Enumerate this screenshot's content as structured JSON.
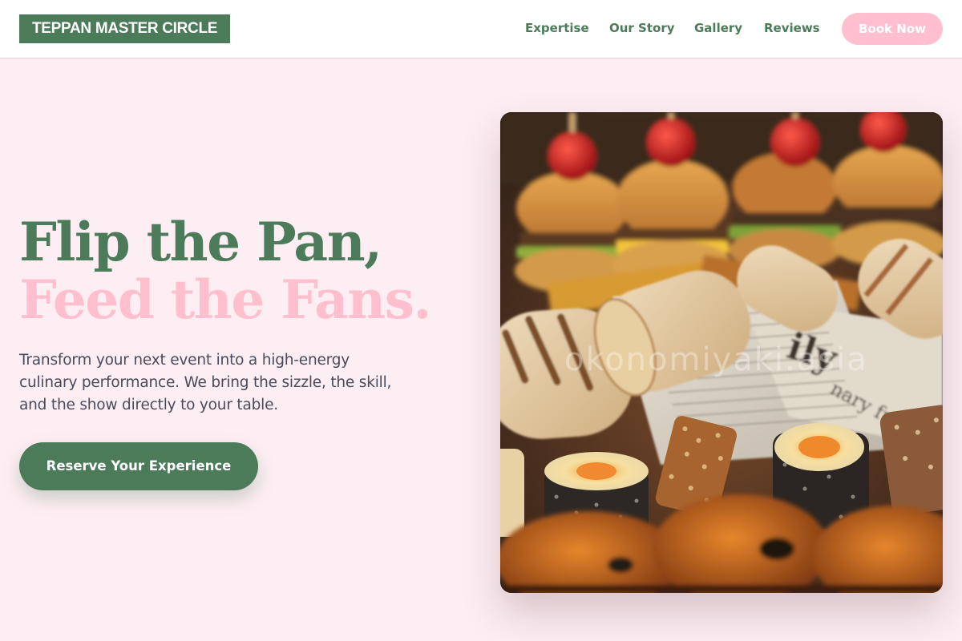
{
  "brand": {
    "name": "TEPPAN MASTER CIRCLE"
  },
  "nav": {
    "items": [
      "Expertise",
      "Our Story",
      "Gallery",
      "Reviews"
    ],
    "cta_label": "Book Now"
  },
  "hero": {
    "headline_line1": "Flip the Pan,",
    "headline_line2": "Feed the Fans.",
    "description": "Transform your next event into a high-energy culinary performance. We bring the sizzle, the skill, and the show directly to your table.",
    "cta_label": "Reserve Your Experience",
    "image_alt": "Platter of mini burgers, wraps in newspaper, sushi rolls and grilled bites",
    "image_watermark": "okonomiyaki.asia"
  },
  "colors": {
    "brand_green": "#4b7b59",
    "accent_pink": "#ffbfcf",
    "page_bg": "#fdeef3",
    "body_text": "#4a4a5a"
  }
}
